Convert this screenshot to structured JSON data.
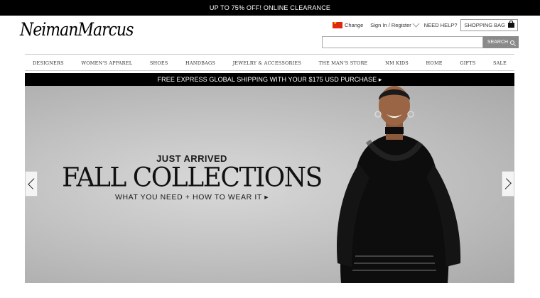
{
  "promo_bar": {
    "text": "UP TO 75% OFF! ONLINE CLEARANCE"
  },
  "logo": {
    "text": "NeimanMarcus"
  },
  "utility": {
    "change_label": "Change",
    "signin_label": "Sign In / Register",
    "help_label": "NEED HELP?",
    "bag_label": "SHOPPING BAG",
    "flag_icon": "china-flag-icon",
    "bag_icon": "shopping-bag-icon"
  },
  "search": {
    "value": "",
    "placeholder": "",
    "button_label": "SEARCH",
    "icon": "magnifier-icon"
  },
  "nav": {
    "items": [
      "DESIGNERS",
      "WOMEN'S APPAREL",
      "SHOES",
      "HANDBAGS",
      "JEWELRY & ACCESSORIES",
      "THE MAN'S STORE",
      "NM KIDS",
      "HOME",
      "GIFTS",
      "SALE"
    ]
  },
  "shipping_bar": {
    "text": "FREE EXPRESS GLOBAL SHIPPING WITH YOUR $175 USD PURCHASE ▸"
  },
  "hero": {
    "kicker": "JUST ARRIVED",
    "headline": "FALL COLLECTIONS",
    "subline": "WHAT YOU NEED + HOW TO WEAR IT ▸",
    "prev_icon": "chevron-left-icon",
    "next_icon": "chevron-right-icon"
  },
  "colors": {
    "black": "#000000",
    "hero_bg": "#c4c4c4",
    "search_button": "#8a8a8a",
    "flag_red": "#de2910"
  }
}
